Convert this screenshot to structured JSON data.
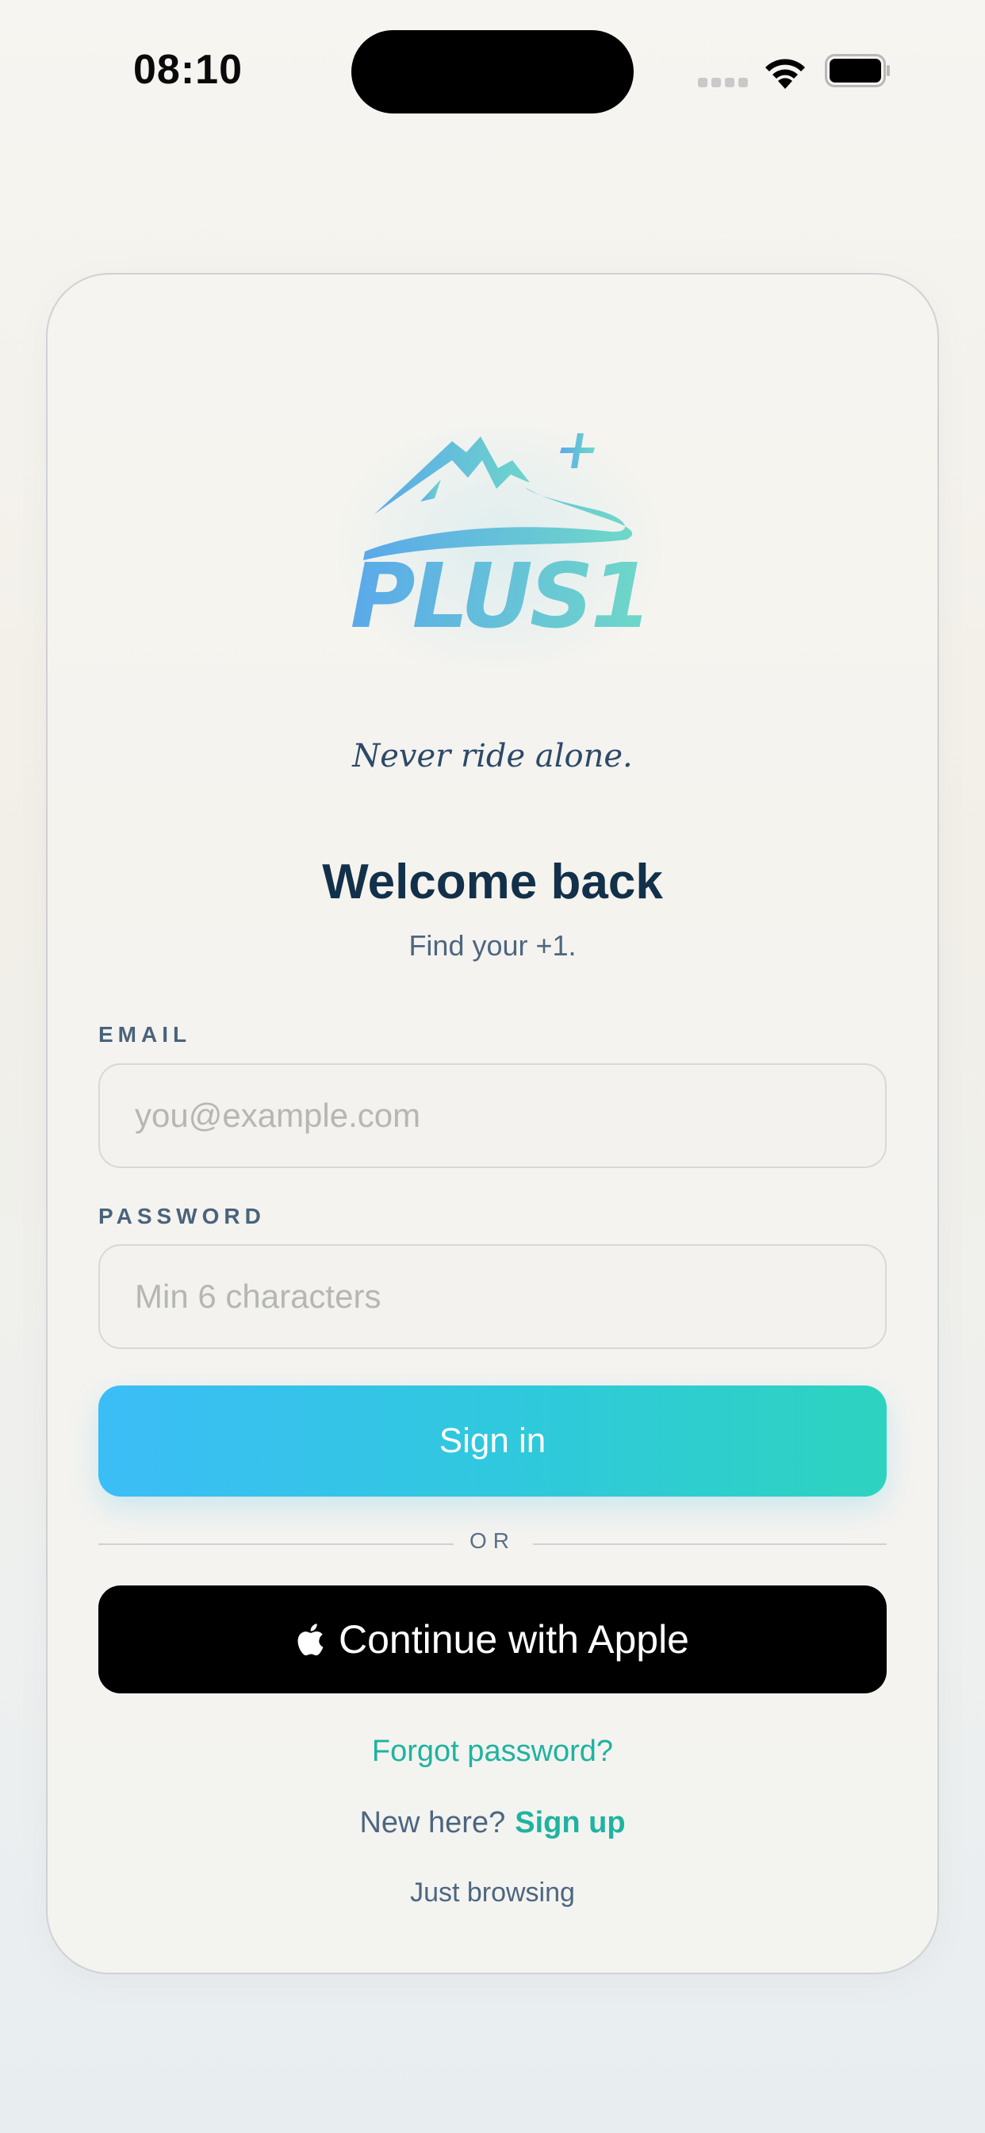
{
  "status_bar": {
    "time": "08:10",
    "icons": [
      "signal-dots-icon",
      "wifi-icon",
      "battery-icon"
    ]
  },
  "logo": {
    "wordmark": "PLUS1",
    "colors": {
      "start": "#5aa9ea",
      "end": "#6fd8c8"
    }
  },
  "tagline": "Never ride alone.",
  "welcome": {
    "title": "Welcome back",
    "subtitle": "Find your +1."
  },
  "form": {
    "email": {
      "label": "EMAIL",
      "value": "",
      "placeholder": "you@example.com"
    },
    "password": {
      "label": "PASSWORD",
      "value": "",
      "placeholder": "Min 6 characters"
    },
    "signin_label": "Sign in",
    "divider_label": "OR",
    "apple_label": "Continue with Apple"
  },
  "links": {
    "forgot": "Forgot password?",
    "new_here": "New here?",
    "signup": "Sign up",
    "browse": "Just browsing"
  },
  "colors": {
    "accent": "#1fb3a0",
    "button_gradient_start": "#3bbdf6",
    "button_gradient_end": "#2ed3bf",
    "title": "#12304a"
  }
}
